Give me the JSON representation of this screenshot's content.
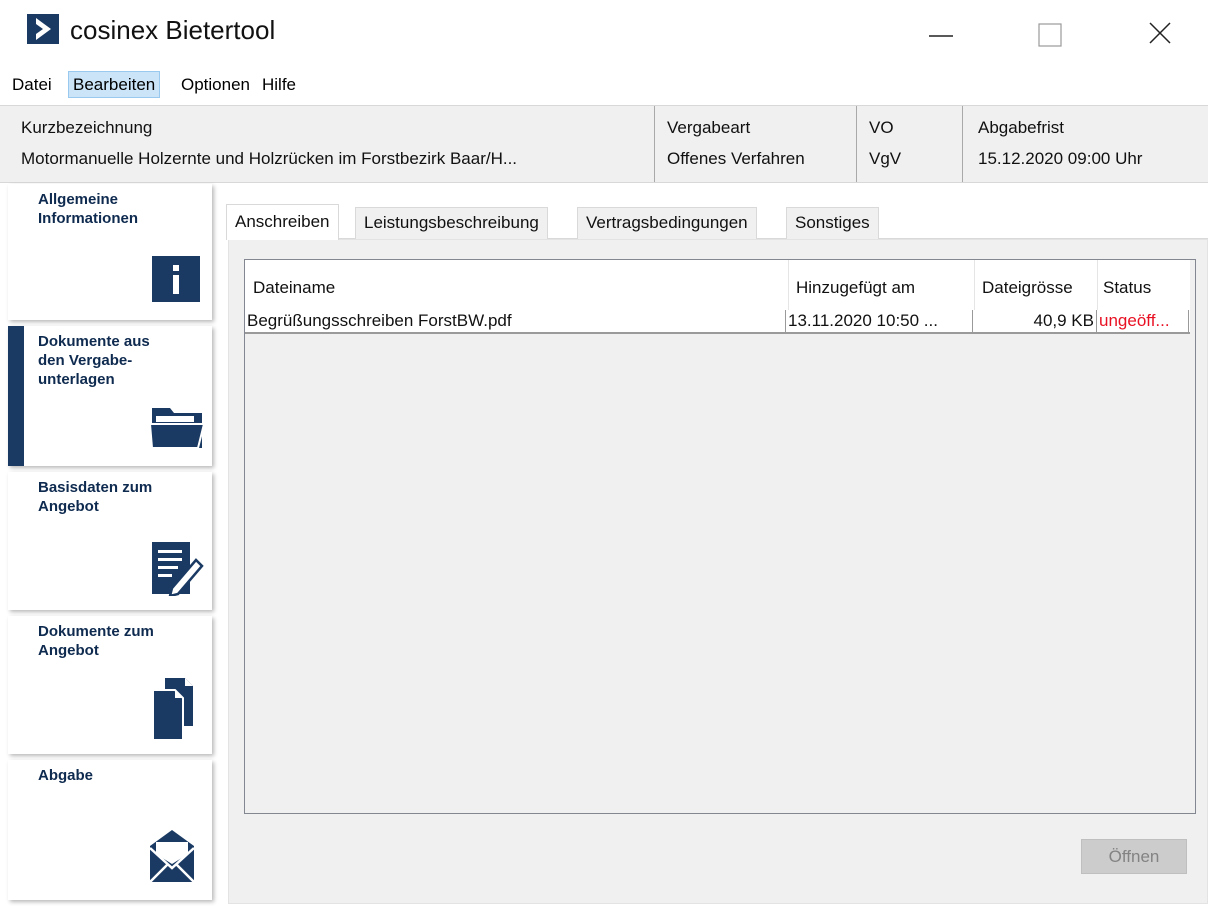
{
  "window": {
    "title": "cosinex Bietertool",
    "logo_icon": "chevron-right-icon",
    "controls": [
      "minimize-icon",
      "maximize-icon",
      "close-icon"
    ]
  },
  "menu": {
    "items": [
      "Datei",
      "Bearbeiten",
      "Optionen",
      "Hilfe"
    ],
    "active": "Bearbeiten"
  },
  "header": {
    "kurzbezeichnung_label": "Kurzbezeichnung",
    "kurzbezeichnung_value": "Motormanuelle Holzernte und Holzrücken im Forstbezirk Baar/H...",
    "vergabeart_label": "Vergabeart",
    "vergabeart_value": "Offenes Verfahren",
    "vo_label": "VO",
    "vo_value": "VgV",
    "abgabefrist_label": "Abgabefrist",
    "abgabefrist_value": "15.12.2020 09:00 Uhr"
  },
  "sidebar": {
    "items": [
      {
        "label": "Allgemeine\nInformationen",
        "icon": "info-icon",
        "selected": false
      },
      {
        "label": "Dokumente aus\nden Vergabe-\nunterlagen",
        "icon": "folder-icon",
        "selected": true
      },
      {
        "label": "Basisdaten zum\nAngebot",
        "icon": "edit-document-icon",
        "selected": false
      },
      {
        "label": "Dokumente zum\nAngebot",
        "icon": "documents-icon",
        "selected": false
      },
      {
        "label": "Abgabe",
        "icon": "envelope-icon",
        "selected": false
      }
    ],
    "accent_color": "#1a3a63"
  },
  "tabs": {
    "items": [
      "Anschreiben",
      "Leistungsbeschreibung",
      "Vertragsbedingungen",
      "Sonstiges"
    ],
    "active": "Anschreiben"
  },
  "table": {
    "columns": [
      "Dateiname",
      "Hinzugefügt am",
      "Dateigrösse",
      "Status"
    ],
    "rows": [
      {
        "dateiname": "Begrüßungsschreiben ForstBW.pdf",
        "hinzugefuegt": "13.11.2020 10:50 ...",
        "groesse": "40,9 KB",
        "status": "ungeöff...",
        "status_color": "#e81123"
      }
    ]
  },
  "buttons": {
    "open_label": "Öffnen",
    "open_enabled": false
  }
}
